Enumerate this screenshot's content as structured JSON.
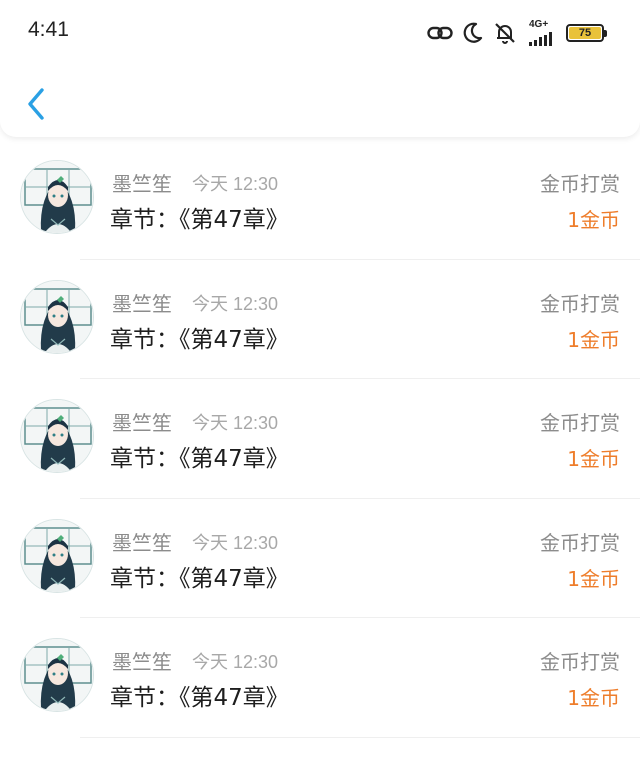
{
  "status_bar": {
    "time": "4:41",
    "network_type": "4G+",
    "battery_level": "75",
    "icons": [
      "link-icon",
      "moon-icon",
      "mute-icon",
      "signal-icon",
      "battery-icon"
    ]
  },
  "nav": {
    "back_icon": "chevron-left-icon",
    "accent_color": "#2aa0e4"
  },
  "records": [
    {
      "name": "墨竺笙",
      "date": "今天 12:30",
      "chapter": "章节：《第47章》",
      "type": "金币打赏",
      "amount": "1金币"
    },
    {
      "name": "墨竺笙",
      "date": "今天 12:30",
      "chapter": "章节：《第47章》",
      "type": "金币打赏",
      "amount": "1金币"
    },
    {
      "name": "墨竺笙",
      "date": "今天 12:30",
      "chapter": "章节：《第47章》",
      "type": "金币打赏",
      "amount": "1金币"
    },
    {
      "name": "墨竺笙",
      "date": "今天 12:30",
      "chapter": "章节：《第47章》",
      "type": "金币打赏",
      "amount": "1金币"
    },
    {
      "name": "墨竺笙",
      "date": "今天 12:30",
      "chapter": "章节：《第47章》",
      "type": "金币打赏",
      "amount": "1金币"
    }
  ],
  "colors": {
    "amount": "#ee7d2b",
    "secondary_text": "#8c8c8c",
    "primary_text": "#1e1e1e"
  }
}
